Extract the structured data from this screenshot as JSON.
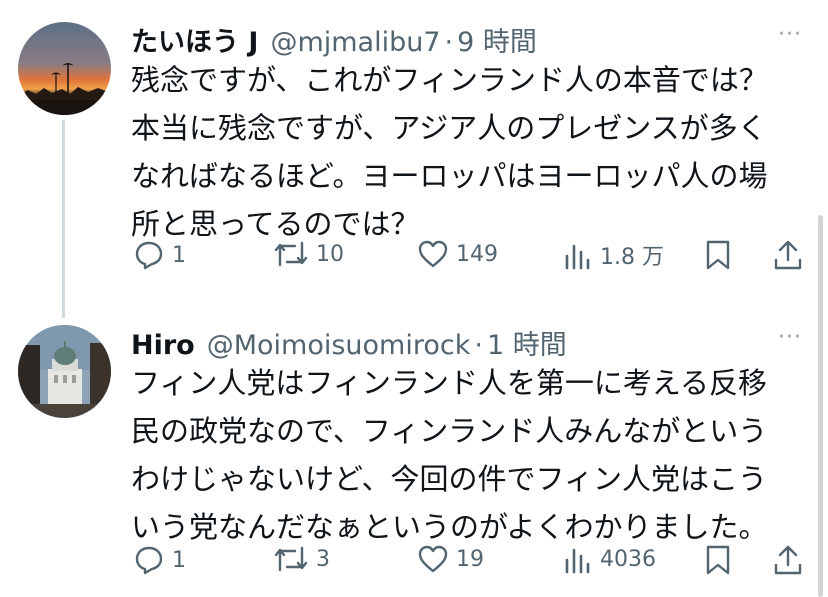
{
  "tweets": [
    {
      "name": "たいほう J",
      "handle": "@mjmalibu7",
      "separator": "·",
      "time": "9 時間",
      "body": [
        "残念ですが、これがフィンランド人の本音では？",
        "本当に残念ですが、アジア人のプレゼンスが多く",
        "なればなるほど。ヨーロッパはヨーロッパ人の場",
        "所と思ってるのでは？"
      ],
      "replies": "1",
      "retweets": "10",
      "likes": "149",
      "views": "1.8 万"
    },
    {
      "name": "Hiro",
      "handle": "@Moimoisuomirock",
      "separator": "·",
      "time": "1 時間",
      "body": [
        "フィン人党はフィンランド人を第一に考える反移",
        "民の政党なので、フィンランド人みんながという",
        "わけじゃないけど、今回の件でフィン人党はこう",
        "いう党なんだなぁというのがよくわかりました。"
      ],
      "replies": "1",
      "retweets": "3",
      "likes": "19",
      "views": "4036"
    }
  ],
  "more_label": "···",
  "icons": [
    "reply-icon",
    "retweet-icon",
    "like-icon",
    "views-icon",
    "bookmark-icon",
    "share-icon"
  ]
}
